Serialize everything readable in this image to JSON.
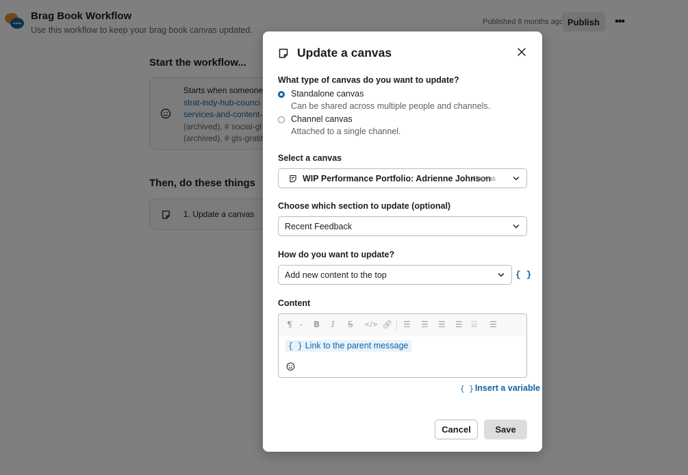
{
  "background": {
    "workflow_title": "Brag Book Workflow",
    "workflow_subtitle": "Use this workflow to keep your brag book canvas updated.",
    "published_text": "Published 6 months ago",
    "publish_label": "Publish",
    "more_label": "•••",
    "start_heading": "Start the workflow...",
    "trigger_lines": [
      "Starts when someone",
      "strat-indy-hub-counci",
      "services-and-content-",
      "(archived), # social-gl",
      "(archived), # gls-gratit"
    ],
    "then_heading": "Then, do these things",
    "step_label": "1. Update a canvas"
  },
  "modal": {
    "title": "Update a canvas",
    "canvas_type_label": "What type of canvas do you want to update?",
    "options": [
      {
        "title": "Standalone canvas",
        "desc": "Can be shared across multiple people and channels.",
        "checked": true
      },
      {
        "title": "Channel canvas",
        "desc": "Attached to a single channel.",
        "checked": false
      }
    ],
    "select_canvas_label": "Select a canvas",
    "selected_canvas": "WIP Performance Portfolio: Adrienne Johnson",
    "selected_canvas_tag": "Canvas",
    "section_label": "Choose which section to update (optional)",
    "section_value": "Recent Feedback",
    "how_label": "How do you want to update?",
    "how_value": "Add new content to the top",
    "var_button": "{ }",
    "content_label": "Content",
    "content_chip_brace": "{ }",
    "content_chip_text": "Link to the parent message",
    "insert_variable_brace": "{ }",
    "insert_variable_label": "Insert a variable",
    "cancel_label": "Cancel",
    "save_label": "Save"
  },
  "colors": {
    "accent": "#1264a3",
    "overlay": "rgba(0,0,0,0.5)"
  }
}
